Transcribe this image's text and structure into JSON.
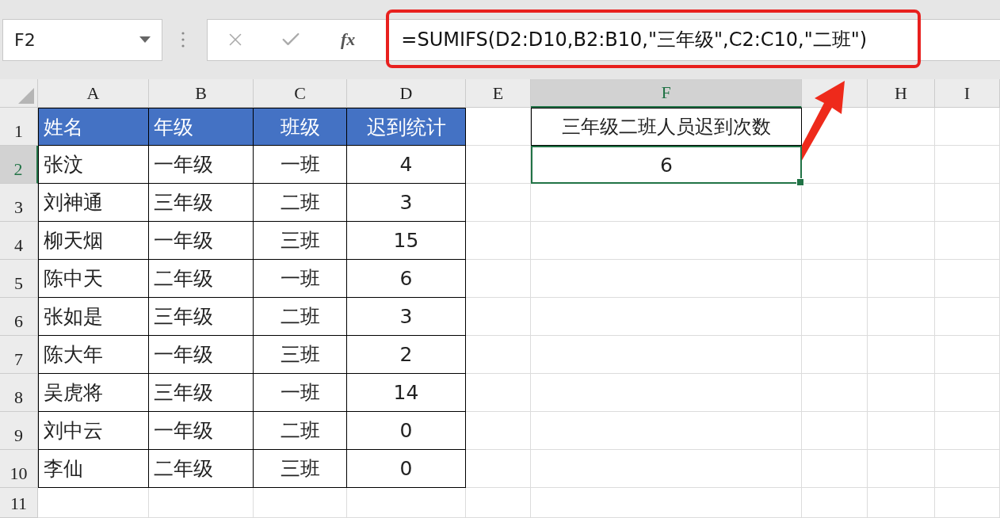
{
  "formula_bar": {
    "name_box": "F2",
    "function_label": "fx",
    "formula": "=SUMIFS(D2:D10,B2:B10,\"三年级\",C2:C10,\"二班\")",
    "highlighted": true
  },
  "columns": [
    {
      "label": "A",
      "selected": false
    },
    {
      "label": "B",
      "selected": false
    },
    {
      "label": "C",
      "selected": false
    },
    {
      "label": "D",
      "selected": false
    },
    {
      "label": "E",
      "selected": false
    },
    {
      "label": "F",
      "selected": true
    },
    {
      "selected": false
    },
    {
      "label": "H",
      "selected": false
    },
    {
      "label": "I",
      "selected": false
    }
  ],
  "rows": [
    {
      "label": "1",
      "selected": false
    },
    {
      "label": "2",
      "selected": true
    },
    {
      "label": "3",
      "selected": false
    },
    {
      "label": "4",
      "selected": false
    },
    {
      "label": "5",
      "selected": false
    },
    {
      "label": "6",
      "selected": false
    },
    {
      "label": "7",
      "selected": false
    },
    {
      "label": "8",
      "selected": false
    },
    {
      "label": "9",
      "selected": false
    },
    {
      "label": "10",
      "selected": false
    },
    {
      "label": "11",
      "selected": false
    }
  ],
  "table": {
    "headers": [
      "姓名",
      "年级",
      "班级",
      "迟到统计"
    ],
    "records": [
      [
        "张汶",
        "一年级",
        "一班",
        "4"
      ],
      [
        "刘神通",
        "三年级",
        "二班",
        "3"
      ],
      [
        "柳天烟",
        "一年级",
        "三班",
        "15"
      ],
      [
        "陈中天",
        "二年级",
        "一班",
        "6"
      ],
      [
        "张如是",
        "三年级",
        "二班",
        "3"
      ],
      [
        "陈大年",
        "一年级",
        "三班",
        "2"
      ],
      [
        "吴虎将",
        "三年级",
        "一班",
        "14"
      ],
      [
        "刘中云",
        "一年级",
        "二班",
        "0"
      ],
      [
        "李仙",
        "二年级",
        "三班",
        "0"
      ]
    ]
  },
  "result": {
    "label": "三年级二班人员迟到次数",
    "value": "6",
    "selected": true
  },
  "annotation_arrow": true
}
